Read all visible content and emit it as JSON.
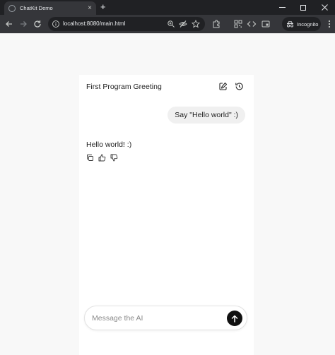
{
  "browser": {
    "tab_title": "ChatKit Demo",
    "tab_close": "×",
    "new_tab": "+",
    "url": "localhost:8080/main.html",
    "incognito_label": "Incognito"
  },
  "chat": {
    "title": "First Program Greeting",
    "messages": [
      {
        "role": "user",
        "text": "Say \"Hello world\" :)"
      },
      {
        "role": "assistant",
        "text": "Hello world! :)"
      }
    ],
    "composer_placeholder": "Message the AI"
  },
  "icons": {
    "header": [
      "compose-icon",
      "history-icon"
    ],
    "message_actions": [
      "copy-icon",
      "thumbs-up-icon",
      "thumbs-down-icon"
    ],
    "send": "arrow-up-icon"
  },
  "colors": {
    "browser_frame": "#202124",
    "browser_toolbar": "#35363a",
    "page_background": "#f8f8f8",
    "panel_background": "#ffffff",
    "user_bubble": "#f0f0f0",
    "send_button": "#111111"
  }
}
